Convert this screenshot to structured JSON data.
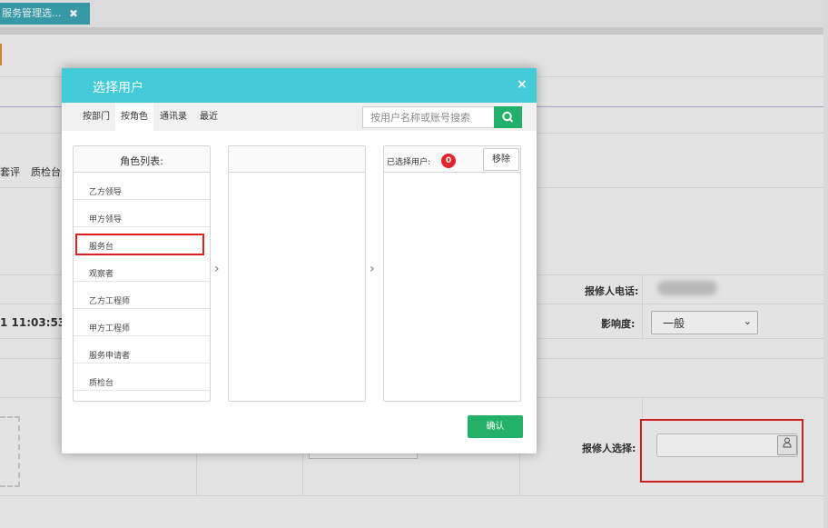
{
  "browser_tab": {
    "title": "服务管理选...",
    "close": "✖"
  },
  "background": {
    "row_labels": [
      "套评",
      "质检台"
    ],
    "time_text": "1 11:03:53",
    "reporter_phone_label": "报修人电话:",
    "impact_label": "影响度:",
    "impact_value": "一般",
    "reporter_select_label": "报修人选择:"
  },
  "modal": {
    "title": "选择用户",
    "close": "×",
    "tabs": [
      {
        "label": "按部门",
        "active": false
      },
      {
        "label": "按角色",
        "active": true
      },
      {
        "label": "通讯录",
        "active": false
      },
      {
        "label": "最近",
        "active": false
      }
    ],
    "search": {
      "placeholder": "按用户名称或账号搜索"
    },
    "roles_title": "角色列表:",
    "roles": [
      "乙方领导",
      "甲方领导",
      "服务台",
      "观察者",
      "乙方工程师",
      "甲方工程师",
      "服务申请者",
      "质检台"
    ],
    "highlighted_role": "服务台",
    "arrow": "›",
    "selected_label": "已选择用户:",
    "selected_count": "0",
    "remove_label": "移除",
    "confirm_label": "确认"
  },
  "colors": {
    "header": "#43cbd9",
    "tab_bar": "#3aa8b4",
    "confirm": "#25b06a",
    "search_button": "#22b16a",
    "highlight": "#e02020",
    "badge": "#e0252b"
  },
  "icons": {
    "search": "search-icon",
    "user": "user-icon",
    "close": "close-icon",
    "arrow": "chevron-right-icon"
  }
}
